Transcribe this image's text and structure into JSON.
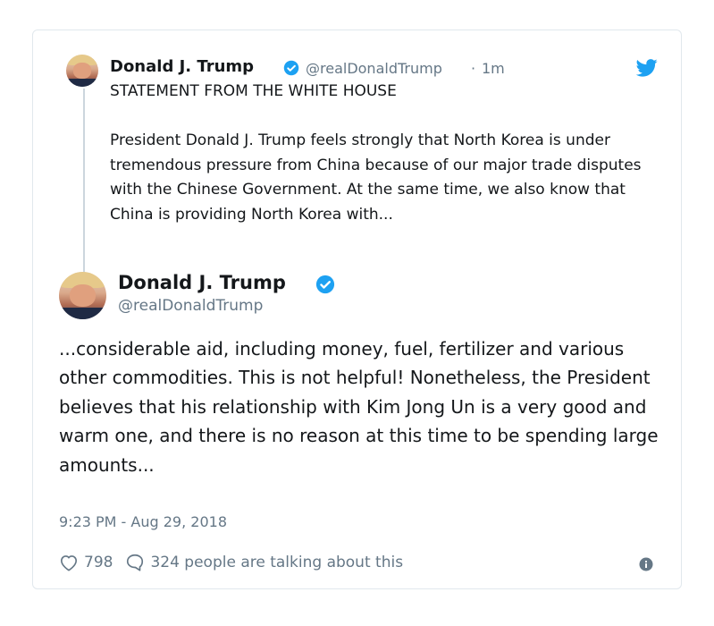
{
  "quoted_tweet": {
    "display_name": "Donald J. Trump",
    "handle": "@realDonaldTrump",
    "separator": "·",
    "time_ago": "1m",
    "headline": "STATEMENT FROM THE WHITE HOUSE",
    "body": "President Donald J. Trump feels strongly that North Korea is under tremendous pressure from China because of our major trade disputes with the Chinese Government. At the same time, we also know that China is providing North Korea with..."
  },
  "main_tweet": {
    "display_name": "Donald J. Trump",
    "handle": "@realDonaldTrump",
    "body": "...considerable aid, including money, fuel, fertilizer and various other commodities. This is not helpful! Nonetheless, the President believes that his relationship with Kim Jong Un is a very good and warm one, and there is no reason at this time to be spending large amounts...",
    "timestamp": "9:23 PM - Aug 29, 2018"
  },
  "actions": {
    "likes": "798",
    "replies_text": "324 people are talking about this"
  },
  "icons": {
    "verified": "verified-badge-icon",
    "twitter": "twitter-bird-icon",
    "like": "heart-icon",
    "reply": "speech-bubble-icon",
    "info": "info-icon"
  },
  "colors": {
    "twitter_blue": "#1da1f2",
    "secondary_text": "#657786",
    "border": "#e1e8ed"
  }
}
